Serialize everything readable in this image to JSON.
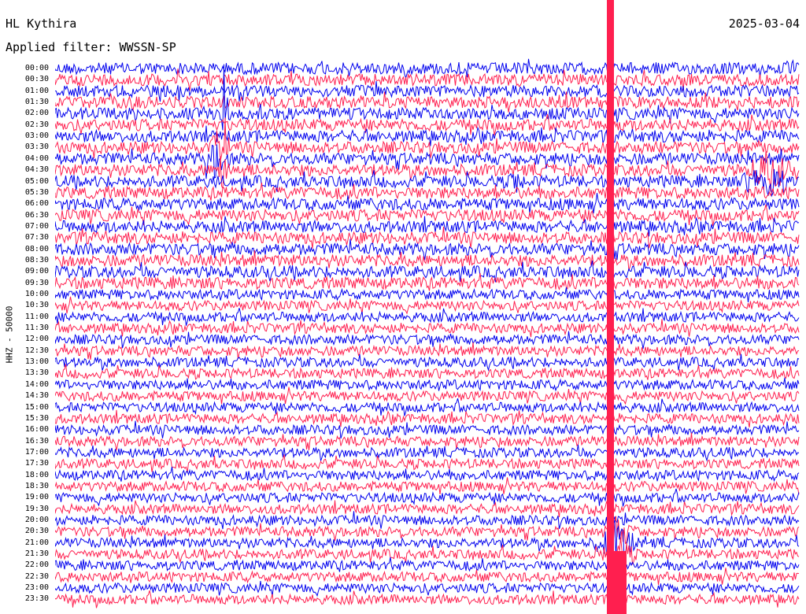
{
  "header": {
    "station": "HL Kythira",
    "date": "2025-03-04",
    "filter": "Applied filter: WWSSN-SP"
  },
  "channel_label": "HHZ - 50000",
  "colors": {
    "trace_a": "#0000ee",
    "trace_b": "#ff1f4f",
    "background": "#ffffff"
  },
  "chart_data": {
    "type": "line",
    "title": "HL Kythira",
    "subtitle": "Applied filter: WWSSN-SP",
    "date": "2025-03-04",
    "ylabel": "HHZ - 50000",
    "row_labels": [
      "00:00",
      "00:30",
      "01:00",
      "01:30",
      "02:00",
      "02:30",
      "03:00",
      "03:30",
      "04:00",
      "04:30",
      "05:00",
      "05:30",
      "06:00",
      "06:30",
      "07:00",
      "07:30",
      "08:00",
      "08:30",
      "09:00",
      "09:30",
      "10:00",
      "10:30",
      "11:00",
      "11:30",
      "12:00",
      "12:30",
      "13:00",
      "13:30",
      "14:00",
      "14:30",
      "15:00",
      "15:30",
      "16:00",
      "16:30",
      "17:00",
      "17:30",
      "18:00",
      "18:30",
      "19:00",
      "19:30",
      "20:00",
      "20:30",
      "21:00",
      "21:30",
      "22:00",
      "22:30",
      "23:00",
      "23:30"
    ],
    "series": [
      {
        "color": "#0000ee",
        "rows": "even"
      },
      {
        "color": "#ff1f4f",
        "rows": "odd"
      }
    ]
  }
}
